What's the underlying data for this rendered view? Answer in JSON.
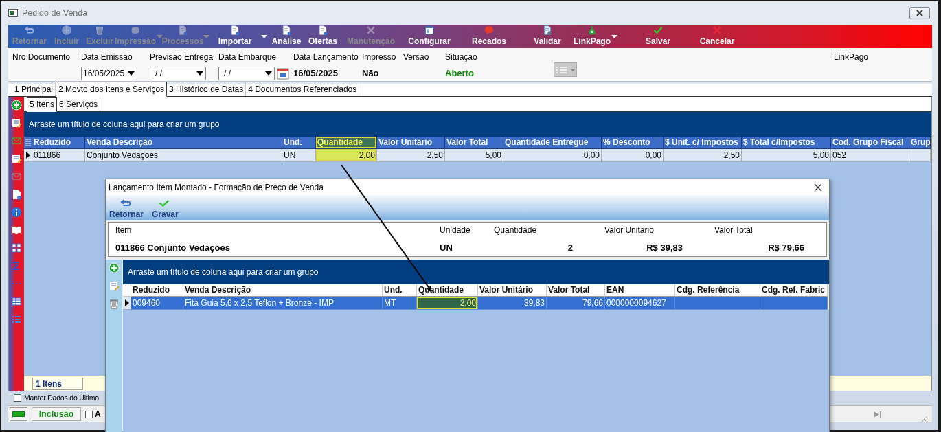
{
  "window": {
    "title": "Pedido de Venda"
  },
  "toolbar": [
    {
      "label": "Retornar",
      "disabled": true,
      "dropdown": false
    },
    {
      "label": "Incluir",
      "disabled": true,
      "dropdown": false
    },
    {
      "label": "Excluir",
      "disabled": true,
      "dropdown": false
    },
    {
      "label": "Impressão",
      "disabled": true,
      "dropdown": true
    },
    {
      "label": "Processos",
      "disabled": true,
      "dropdown": true
    },
    {
      "label": "Importar",
      "disabled": false,
      "dropdown": true
    },
    {
      "label": "Análise",
      "disabled": false,
      "dropdown": false
    },
    {
      "label": "Ofertas",
      "disabled": false,
      "dropdown": false
    },
    {
      "label": "Manutenção",
      "disabled": true,
      "dropdown": false
    },
    {
      "label": "Configurar",
      "disabled": false,
      "dropdown": false
    },
    {
      "label": "Recados",
      "disabled": false,
      "dropdown": false
    },
    {
      "label": "Validar",
      "disabled": false,
      "dropdown": false
    },
    {
      "label": "LinkPago",
      "disabled": false,
      "dropdown": true
    },
    {
      "label": "Salvar",
      "disabled": false,
      "dropdown": false
    },
    {
      "label": "Cancelar",
      "disabled": false,
      "dropdown": false
    }
  ],
  "header": {
    "fields": [
      {
        "label": "Nro Documento",
        "kind": "empty"
      },
      {
        "label": "Data Emissão",
        "kind": "dropdown",
        "value": "16/05/2025"
      },
      {
        "label": "Previsão Entrega",
        "kind": "dropdown",
        "value": "/ /"
      },
      {
        "label": "Data Embarque",
        "kind": "dropdown",
        "value": "/ /",
        "calendar": true
      },
      {
        "label": "Data Lançamento",
        "kind": "text",
        "value": "16/05/2025"
      },
      {
        "label": "Impresso",
        "kind": "text",
        "value": "Não"
      },
      {
        "label": "Versão",
        "kind": "empty"
      },
      {
        "label": "Situação",
        "kind": "status",
        "value": "Aberto"
      },
      {
        "label": "LinkPago",
        "kind": "empty"
      }
    ],
    "view_button": {
      "disabled": true
    }
  },
  "tabs": [
    {
      "label": "1 Principal",
      "selected": false
    },
    {
      "label": "2 Movto dos Itens e Serviços",
      "selected": true
    },
    {
      "label": "3 Histórico de Datas",
      "selected": false
    },
    {
      "label": "4 Documentos Referenciados",
      "selected": false
    }
  ],
  "subtabs": [
    {
      "label": "5 Itens",
      "selected": true
    },
    {
      "label": "6 Serviços",
      "selected": false
    }
  ],
  "grid": {
    "group_hint": "Arraste um título de coluna aqui para criar um grupo",
    "columns": [
      {
        "label": "Reduzido",
        "kind": "text",
        "highlighted": false
      },
      {
        "label": "Venda Descrição",
        "kind": "text",
        "highlighted": false
      },
      {
        "label": "Und.",
        "kind": "text",
        "highlighted": false
      },
      {
        "label": "Quantidade",
        "kind": "number",
        "highlighted": true
      },
      {
        "label": "Valor Unitário",
        "kind": "number",
        "highlighted": false
      },
      {
        "label": "Valor Total",
        "kind": "number",
        "highlighted": false
      },
      {
        "label": "Quantidade Entregue",
        "kind": "number",
        "highlighted": false
      },
      {
        "label": "% Desconto",
        "kind": "number",
        "highlighted": false
      },
      {
        "label": "$ Unit. c/ Impostos",
        "kind": "number",
        "highlighted": false
      },
      {
        "label": "$ Total c/Impostos",
        "kind": "number",
        "highlighted": false
      },
      {
        "label": "Cod. Grupo Fiscal",
        "kind": "text",
        "highlighted": false
      },
      {
        "label": "Grup",
        "kind": "text",
        "highlighted": false
      }
    ],
    "rows": [
      {
        "current": true,
        "selected": false,
        "cells": [
          "011866",
          "Conjunto Vedações",
          "UN",
          "2,00",
          "2,50",
          "5,00",
          "0,00",
          "0,00",
          "2,50",
          "5,00",
          "052",
          ""
        ]
      }
    ],
    "footer": "1 Itens"
  },
  "keep_data": {
    "label": "Manter Dados do Último",
    "checked": false
  },
  "status_bar": {
    "mode": "Inclusão",
    "option": {
      "label": "A",
      "checked": false
    }
  },
  "dialog": {
    "title": "Lançamento Item Montado - Formação de Preço de Venda",
    "toolbar": [
      {
        "label": "Retornar"
      },
      {
        "label": "Gravar"
      }
    ],
    "item_panel": [
      {
        "label": "Item",
        "value": "011866 Conjunto Vedações"
      },
      {
        "label": "Unidade",
        "value": "UN"
      },
      {
        "label": "Quantidade",
        "value": "2"
      },
      {
        "label": "Valor Unitário",
        "value": "R$ 39,83"
      },
      {
        "label": "Valor Total",
        "value": "R$ 79,66"
      }
    ],
    "grid": {
      "group_hint": "Arraste um título de coluna aqui para criar um grupo",
      "columns": [
        {
          "label": "Reduzido",
          "kind": "text",
          "highlighted": false
        },
        {
          "label": "Venda Descrição",
          "kind": "text",
          "highlighted": false
        },
        {
          "label": "Und.",
          "kind": "text",
          "highlighted": false
        },
        {
          "label": "Quantidade",
          "kind": "number",
          "highlighted": true
        },
        {
          "label": "Valor Unitário",
          "kind": "number",
          "highlighted": false
        },
        {
          "label": "Valor Total",
          "kind": "number",
          "highlighted": false
        },
        {
          "label": "EAN",
          "kind": "text",
          "highlighted": false
        },
        {
          "label": "Cdg. Referência",
          "kind": "text",
          "highlighted": false
        },
        {
          "label": "Cdg. Ref. Fabric",
          "kind": "text",
          "highlighted": false
        }
      ],
      "rows": [
        {
          "current": true,
          "selected": true,
          "cells": [
            "009460",
            "Fita Guia 5,6 x 2,5 Teflon + Bronze - IMP",
            "MT",
            "2,00",
            "39,83",
            "79,66",
            "0000000094627",
            "",
            ""
          ]
        }
      ]
    }
  },
  "annotations": {
    "arrow": true
  }
}
